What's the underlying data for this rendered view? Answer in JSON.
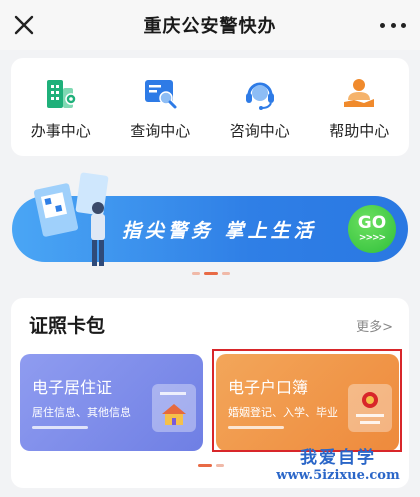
{
  "header": {
    "title": "重庆公安警快办"
  },
  "services": [
    {
      "label": "办事中心",
      "icon": "office-building-icon"
    },
    {
      "label": "查询中心",
      "icon": "search-screen-icon"
    },
    {
      "label": "咨询中心",
      "icon": "headset-icon"
    },
    {
      "label": "帮助中心",
      "icon": "helping-hand-icon"
    }
  ],
  "banner": {
    "slogan": "指尖警务 掌上生活",
    "go_label": "GO",
    "go_arrows": ">>>>"
  },
  "wallet": {
    "title": "证照卡包",
    "more_label": "更多>",
    "cards": [
      {
        "name": "电子居住证",
        "desc": "居住信息、其他信息"
      },
      {
        "name": "电子户口簿",
        "desc": "婚姻登记、入学、毕业"
      }
    ]
  },
  "watermark": {
    "line1": "我爱自学",
    "line2": "www.5izixue.com"
  },
  "colors": {
    "banner_blue": "#2f7fe6",
    "go_green": "#2fbf3a",
    "residence_card": "#7f8ce9",
    "hukou_card": "#ef9444",
    "highlight_red": "#d8262a",
    "icon_green": "#1fb07a",
    "icon_blue": "#2e7be6",
    "icon_orange": "#f08a2c"
  }
}
